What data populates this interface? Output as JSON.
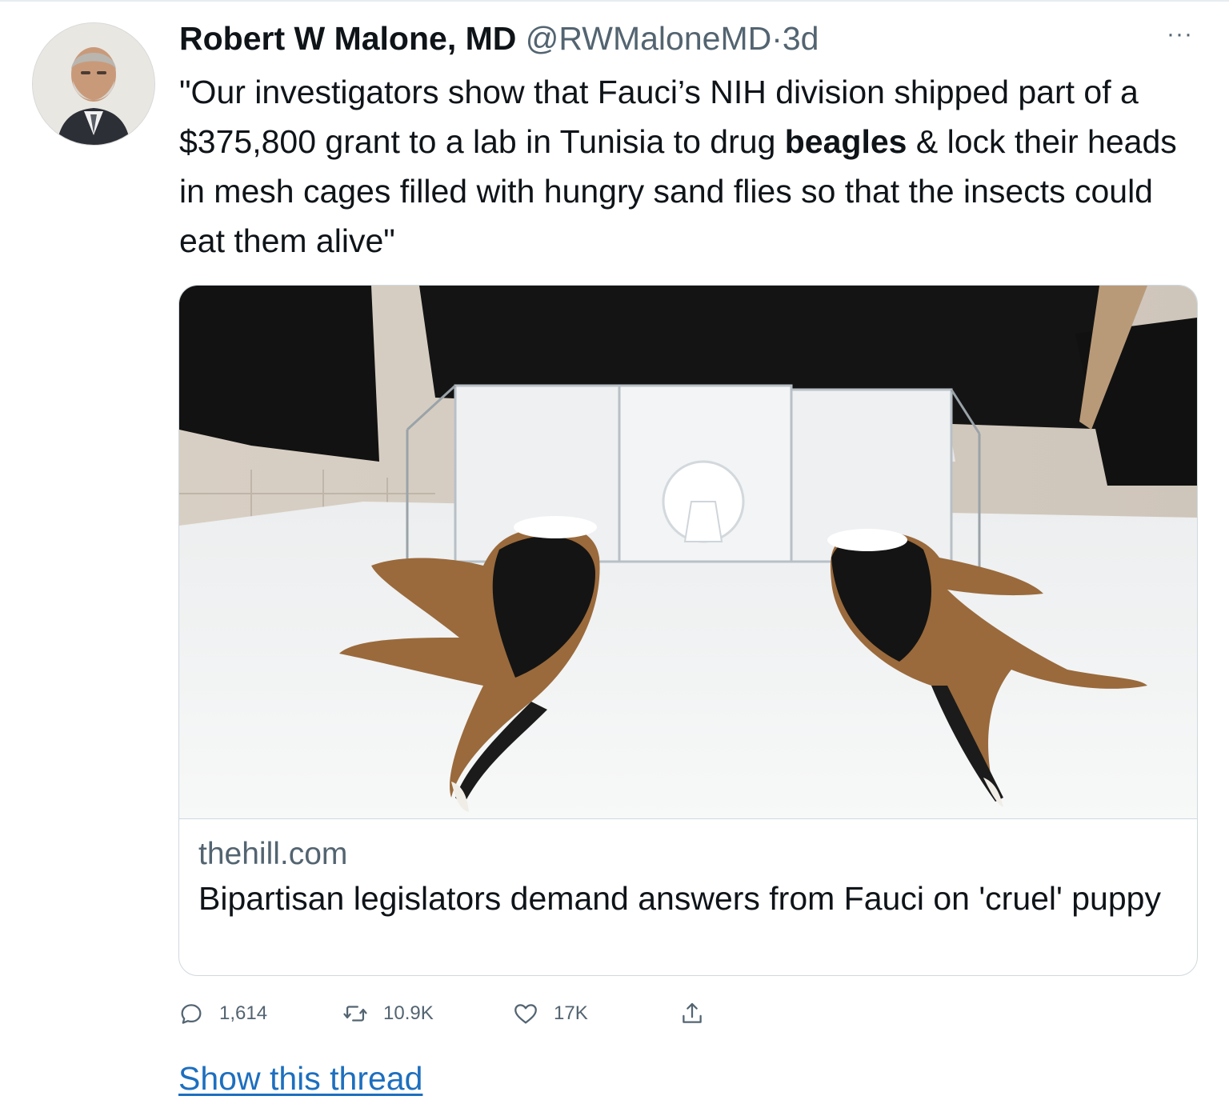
{
  "tweet": {
    "author_name": "Robert W Malone, MD",
    "handle": "@RWMaloneMD",
    "separator": "·",
    "time": "3d",
    "more_label": "···",
    "text_before": "\"Our investigators show that Fauci’s NIH division shipped part of a $375,800 grant to a lab in Tunisia to drug ",
    "text_bold": "beagles",
    "text_after": " & lock their heads in mesh cages filled with hungry sand flies so that the insects could eat them alive\""
  },
  "card": {
    "domain": "thehill.com",
    "title": "Bipartisan legislators demand answers from Fauci on 'cruel' puppy"
  },
  "actions": {
    "reply_count": "1,614",
    "retweet_count": "10.9K",
    "like_count": "17K"
  },
  "footer": {
    "show_thread": "Show this thread"
  },
  "icons": {
    "reply": "reply-icon",
    "retweet": "retweet-icon",
    "like": "heart-icon",
    "share": "share-icon"
  },
  "colors": {
    "text": "#0f1419",
    "secondary": "#536471",
    "link": "#1d6fbf",
    "border": "#cfd9de"
  }
}
